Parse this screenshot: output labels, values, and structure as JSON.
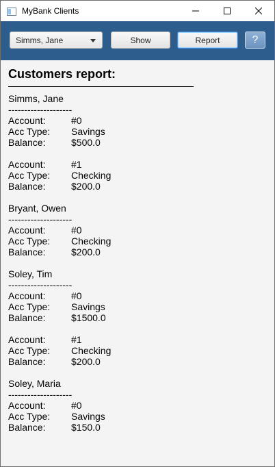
{
  "window": {
    "title": "MyBank Clients"
  },
  "toolbar": {
    "client_select": "Simms, Jane",
    "show_label": "Show",
    "report_label": "Report",
    "help_label": "?"
  },
  "report": {
    "title": "Customers report:",
    "separator": "--------------------",
    "labels": {
      "account": "Account:",
      "acc_type": "Acc Type:",
      "balance": "Balance:"
    },
    "customers": [
      {
        "name": "Simms, Jane",
        "accounts": [
          {
            "account": "#0",
            "type": "Savings",
            "balance": "$500.0"
          },
          {
            "account": "#1",
            "type": "Checking",
            "balance": "$200.0"
          }
        ]
      },
      {
        "name": "Bryant, Owen",
        "accounts": [
          {
            "account": "#0",
            "type": "Checking",
            "balance": "$200.0"
          }
        ]
      },
      {
        "name": "Soley, Tim",
        "accounts": [
          {
            "account": "#0",
            "type": "Savings",
            "balance": "$1500.0"
          },
          {
            "account": "#1",
            "type": "Checking",
            "balance": "$200.0"
          }
        ]
      },
      {
        "name": "Soley, Maria",
        "accounts": [
          {
            "account": "#0",
            "type": "Savings",
            "balance": "$150.0"
          }
        ]
      }
    ]
  }
}
